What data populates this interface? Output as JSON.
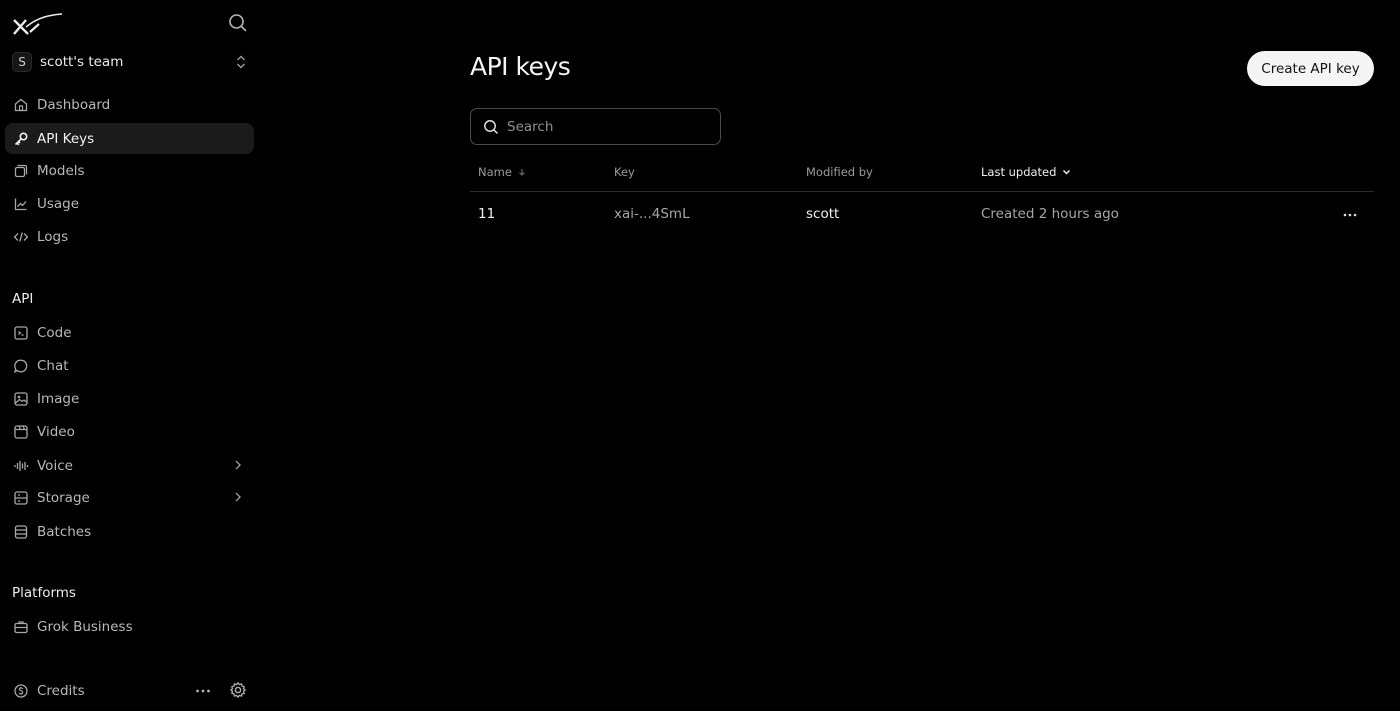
{
  "sidebar": {
    "team": {
      "initial": "S",
      "name": "scott's team"
    },
    "nav": [
      {
        "label": "Dashboard",
        "icon": "home-icon",
        "active": false
      },
      {
        "label": "API Keys",
        "icon": "key-icon",
        "active": true
      },
      {
        "label": "Models",
        "icon": "cube-icon",
        "active": false
      },
      {
        "label": "Usage",
        "icon": "chart-line-icon",
        "active": false
      },
      {
        "label": "Logs",
        "icon": "code-icon",
        "active": false
      }
    ],
    "api_section": {
      "title": "API",
      "items": [
        {
          "label": "Code",
          "icon": "code-square-icon"
        },
        {
          "label": "Chat",
          "icon": "chat-bubble-icon"
        },
        {
          "label": "Image",
          "icon": "image-icon"
        },
        {
          "label": "Video",
          "icon": "video-icon"
        },
        {
          "label": "Voice",
          "icon": "audio-wave-icon",
          "expandable": true
        },
        {
          "label": "Storage",
          "icon": "storage-icon",
          "expandable": true
        },
        {
          "label": "Batches",
          "icon": "database-icon"
        }
      ]
    },
    "platforms_section": {
      "title": "Platforms",
      "items": [
        {
          "label": "Grok Business",
          "icon": "briefcase-icon"
        }
      ]
    },
    "footer": {
      "credits_label": "Credits"
    }
  },
  "main": {
    "title": "API keys",
    "create_button": "Create API key",
    "search_placeholder": "Search",
    "table": {
      "columns": [
        "Name",
        "Key",
        "Modified by",
        "Last updated"
      ],
      "rows": [
        {
          "name": "11",
          "key": "xai-...4SmL",
          "modified_by": "scott",
          "last_updated": "Created 2 hours ago"
        }
      ]
    }
  },
  "colors": {
    "background": "#000000",
    "active_item": "#1b1b1b",
    "button_bg": "#f5f5f5",
    "border": "#4a4a4a"
  }
}
